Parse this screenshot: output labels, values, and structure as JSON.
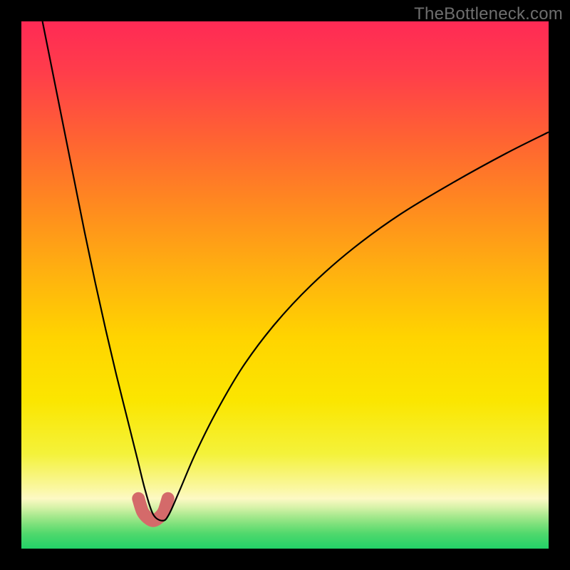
{
  "watermark": "TheBottleneck.com",
  "gradient": {
    "stops": [
      {
        "offset": 0.0,
        "color": "#ff2a55"
      },
      {
        "offset": 0.1,
        "color": "#ff3e4a"
      },
      {
        "offset": 0.22,
        "color": "#ff6233"
      },
      {
        "offset": 0.35,
        "color": "#ff8a1f"
      },
      {
        "offset": 0.48,
        "color": "#ffb20f"
      },
      {
        "offset": 0.6,
        "color": "#ffd400"
      },
      {
        "offset": 0.72,
        "color": "#fbe600"
      },
      {
        "offset": 0.82,
        "color": "#f4f23a"
      },
      {
        "offset": 0.885,
        "color": "#faf7a0"
      },
      {
        "offset": 0.905,
        "color": "#fdf9c4"
      },
      {
        "offset": 0.922,
        "color": "#d6f2a8"
      },
      {
        "offset": 0.938,
        "color": "#a8e98e"
      },
      {
        "offset": 0.955,
        "color": "#7ae07a"
      },
      {
        "offset": 0.972,
        "color": "#4fd86c"
      },
      {
        "offset": 1.0,
        "color": "#22d268"
      }
    ]
  },
  "chart_data": {
    "type": "line",
    "title": "",
    "xlabel": "",
    "ylabel": "",
    "xlim": [
      0,
      100
    ],
    "ylim": [
      0,
      100
    ],
    "series": [
      {
        "name": "bottleneck-curve",
        "x": [
          4,
          6,
          8,
          10,
          12,
          14,
          16,
          18,
          20,
          22,
          23.5,
          25,
          26.8,
          28,
          30,
          33,
          37,
          42,
          48,
          55,
          63,
          72,
          82,
          92,
          100
        ],
        "y": [
          100,
          90,
          80,
          70,
          60,
          50.5,
          41.5,
          33,
          25,
          17,
          11,
          6.5,
          5.3,
          6.5,
          11,
          18,
          26,
          34.5,
          42.5,
          50,
          57,
          63.5,
          69.5,
          75,
          79
        ]
      },
      {
        "name": "highlight-segment",
        "x": [
          22.2,
          23.0,
          24.0,
          25.0,
          26.0,
          27.0,
          27.8
        ],
        "y": [
          9.5,
          7.0,
          5.8,
          5.3,
          5.8,
          7.0,
          9.5
        ]
      }
    ],
    "styles": {
      "bottleneck-curve": {
        "stroke": "#000000",
        "width": 2.2
      },
      "highlight-segment": {
        "stroke": "#d46a6a",
        "width": 18,
        "linecap": "round",
        "linejoin": "round"
      }
    }
  }
}
